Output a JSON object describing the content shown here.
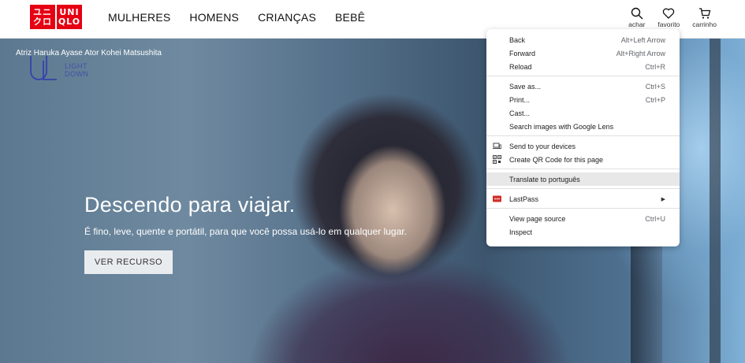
{
  "header": {
    "logo_left_top": "ユニ",
    "logo_left_bottom": "クロ",
    "logo_right_top": "UNI",
    "logo_right_bottom": "QLO",
    "nav": [
      "MULHERES",
      "HOMENS",
      "CRIANÇAS",
      "BEBÊ"
    ],
    "icons": {
      "search": "achar",
      "favorite": "favorito",
      "cart": "carrinho"
    }
  },
  "hero": {
    "credit": "Atriz Haruka Ayase Ator Kohei Matsushita",
    "brand_logo_lines": [
      "",
      "LIGHT",
      "DOWN"
    ],
    "title": "Descendo para viajar.",
    "subtitle": "É fino, leve, quente e portátil, para que você possa usá-lo em qualquer lugar.",
    "button": "VER RECURSO"
  },
  "context_menu": {
    "group1": [
      {
        "label": "Back",
        "shortcut": "Alt+Left Arrow"
      },
      {
        "label": "Forward",
        "shortcut": "Alt+Right Arrow"
      },
      {
        "label": "Reload",
        "shortcut": "Ctrl+R"
      }
    ],
    "group2": [
      {
        "label": "Save as...",
        "shortcut": "Ctrl+S"
      },
      {
        "label": "Print...",
        "shortcut": "Ctrl+P"
      },
      {
        "label": "Cast...",
        "shortcut": ""
      },
      {
        "label": "Search images with Google Lens",
        "shortcut": ""
      }
    ],
    "group3": [
      {
        "label": "Send to your devices",
        "icon": "devices-icon"
      },
      {
        "label": "Create QR Code for this page",
        "icon": "qr-code-icon"
      }
    ],
    "group4": [
      {
        "label": "Translate to português"
      }
    ],
    "group5": [
      {
        "label": "LastPass",
        "icon": "lastpass-icon"
      }
    ],
    "group6": [
      {
        "label": "View page source",
        "shortcut": "Ctrl+U"
      },
      {
        "label": "Inspect",
        "shortcut": ""
      }
    ]
  },
  "colors": {
    "brand_red": "#e60012",
    "menu_highlight": "#e8e8e8"
  }
}
